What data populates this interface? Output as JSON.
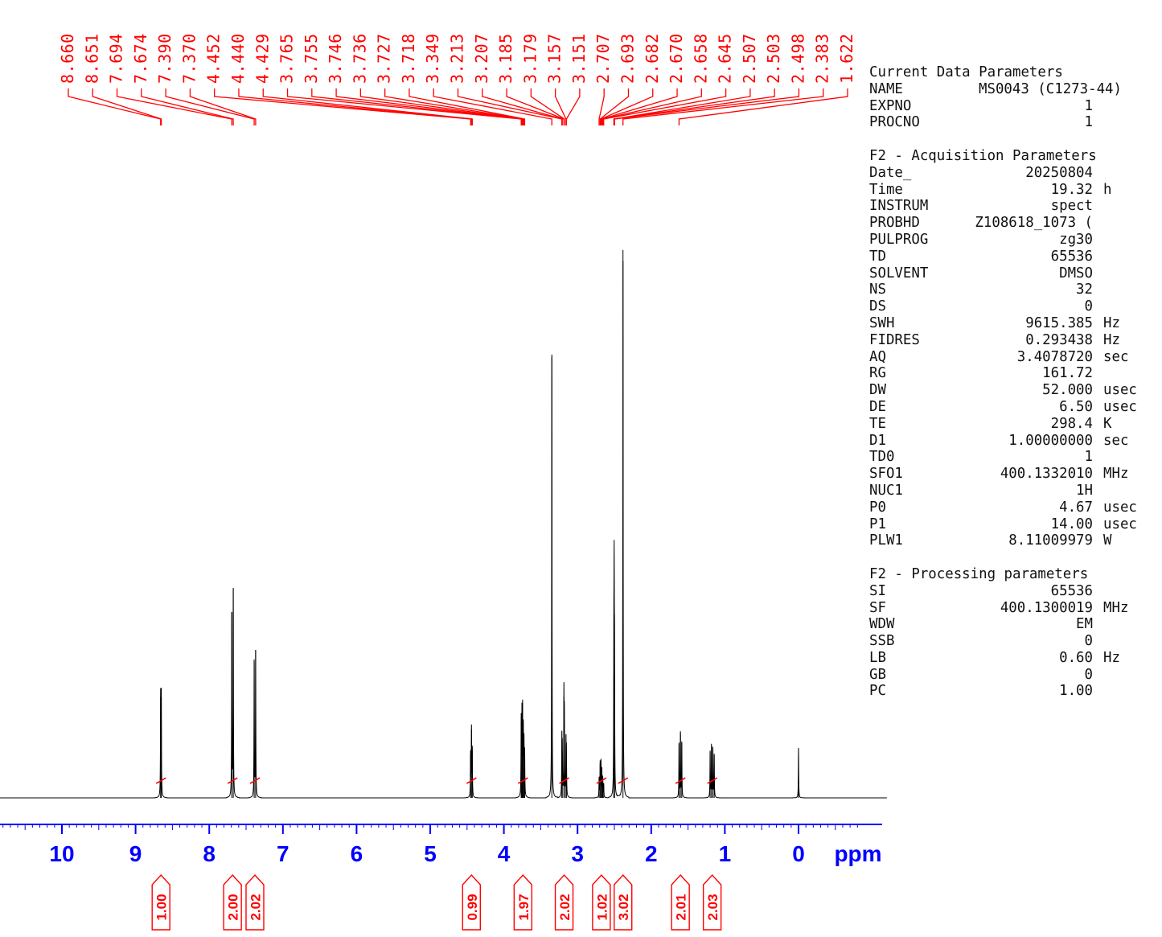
{
  "colors": {
    "spectrum": "#000000",
    "labels": "#ff0000",
    "axis": "#0000ff",
    "integral": "#ff0000"
  },
  "chart_data": {
    "type": "line",
    "description_free": true,
    "x_unit": "ppm",
    "xlim": [
      11.2,
      -0.8
    ],
    "x_reversed": true,
    "x_ticks": [
      "10",
      "9",
      "8",
      "7",
      "6",
      "5",
      "4",
      "3",
      "2",
      "1",
      "0"
    ],
    "x_tick_values": [
      10,
      9,
      8,
      7,
      6,
      5,
      4,
      3,
      2,
      1,
      0
    ],
    "peaks": [
      {
        "ppm": 8.66,
        "height": 0.166
      },
      {
        "ppm": 8.651,
        "height": 0.166
      },
      {
        "ppm": 7.694,
        "height": 0.305
      },
      {
        "ppm": 7.674,
        "height": 0.343
      },
      {
        "ppm": 7.39,
        "height": 0.224
      },
      {
        "ppm": 7.37,
        "height": 0.243
      },
      {
        "ppm": 4.452,
        "height": 0.072
      },
      {
        "ppm": 4.44,
        "height": 0.112
      },
      {
        "ppm": 4.429,
        "height": 0.078
      },
      {
        "ppm": 3.765,
        "height": 0.125
      },
      {
        "ppm": 3.755,
        "height": 0.132
      },
      {
        "ppm": 3.746,
        "height": 0.137
      },
      {
        "ppm": 3.736,
        "height": 0.106
      },
      {
        "ppm": 3.727,
        "height": 0.086
      },
      {
        "ppm": 3.718,
        "height": 0.07
      },
      {
        "ppm": 3.349,
        "height": 0.728
      },
      {
        "ppm": 3.213,
        "height": 0.095
      },
      {
        "ppm": 3.207,
        "height": 0.077
      },
      {
        "ppm": 3.185,
        "height": 0.166
      },
      {
        "ppm": 3.179,
        "height": 0.125
      },
      {
        "ppm": 3.157,
        "height": 0.088
      },
      {
        "ppm": 3.151,
        "height": 0.072
      },
      {
        "ppm": 2.707,
        "height": 0.032
      },
      {
        "ppm": 2.693,
        "height": 0.056
      },
      {
        "ppm": 2.682,
        "height": 0.058
      },
      {
        "ppm": 2.67,
        "height": 0.045
      },
      {
        "ppm": 2.658,
        "height": 0.032
      },
      {
        "ppm": 2.645,
        "height": 0.022
      },
      {
        "ppm": 2.507,
        "height": 0.2
      },
      {
        "ppm": 2.503,
        "height": 0.31
      },
      {
        "ppm": 2.498,
        "height": 0.2
      },
      {
        "ppm": 2.383,
        "height": 0.9
      },
      {
        "ppm": 1.622,
        "height": 0.088
      },
      {
        "ppm": 1.603,
        "height": 0.106
      },
      {
        "ppm": 1.585,
        "height": 0.09
      },
      {
        "ppm": 1.2,
        "height": 0.075
      },
      {
        "ppm": 1.182,
        "height": 0.085
      },
      {
        "ppm": 1.163,
        "height": 0.08
      },
      {
        "ppm": 1.145,
        "height": 0.07
      },
      {
        "ppm": 0.0,
        "height": 0.082
      }
    ],
    "peak_labels": [
      "8.660",
      "8.651",
      "7.694",
      "7.674",
      "7.390",
      "7.370",
      "4.452",
      "4.440",
      "4.429",
      "3.765",
      "3.755",
      "3.746",
      "3.736",
      "3.727",
      "3.718",
      "3.349",
      "3.213",
      "3.207",
      "3.185",
      "3.179",
      "3.157",
      "3.151",
      "2.707",
      "2.693",
      "2.682",
      "2.670",
      "2.658",
      "2.645",
      "2.507",
      "2.503",
      "2.498",
      "2.383",
      "1.622"
    ],
    "integrals": [
      {
        "ppm": 8.655,
        "value": "1.00"
      },
      {
        "ppm": 7.684,
        "value": "2.00"
      },
      {
        "ppm": 7.38,
        "value": "2.02"
      },
      {
        "ppm": 4.44,
        "value": "0.99"
      },
      {
        "ppm": 3.741,
        "value": "1.97"
      },
      {
        "ppm": 3.182,
        "value": "2.02"
      },
      {
        "ppm": 2.676,
        "value": "1.02"
      },
      {
        "ppm": 2.383,
        "value": "3.02"
      },
      {
        "ppm": 1.603,
        "value": "2.01"
      },
      {
        "ppm": 1.172,
        "value": "2.03"
      }
    ]
  },
  "params": [
    {
      "title": "",
      "rows": [
        {
          "key": "Current Data Parameters",
          "value": "",
          "unit": ""
        },
        {
          "key": "NAME",
          "value": "MS0043 (C1273-44)",
          "unit": "",
          "wide": true
        },
        {
          "key": "EXPNO",
          "value": "1",
          "unit": ""
        },
        {
          "key": "PROCNO",
          "value": "1",
          "unit": ""
        }
      ]
    },
    {
      "title": "F2 - Acquisition Parameters",
      "rows": [
        {
          "key": "Date_",
          "value": "20250804",
          "unit": ""
        },
        {
          "key": "Time",
          "value": "19.32",
          "unit": "h"
        },
        {
          "key": "INSTRUM",
          "value": "spect",
          "unit": ""
        },
        {
          "key": "PROBHD",
          "value": "Z108618_1073 (",
          "unit": ""
        },
        {
          "key": "PULPROG",
          "value": "zg30",
          "unit": ""
        },
        {
          "key": "TD",
          "value": "65536",
          "unit": ""
        },
        {
          "key": "SOLVENT",
          "value": "DMSO",
          "unit": ""
        },
        {
          "key": "NS",
          "value": "32",
          "unit": ""
        },
        {
          "key": "DS",
          "value": "0",
          "unit": ""
        },
        {
          "key": "SWH",
          "value": "9615.385",
          "unit": "Hz"
        },
        {
          "key": "FIDRES",
          "value": "0.293438",
          "unit": "Hz"
        },
        {
          "key": "AQ",
          "value": "3.4078720",
          "unit": "sec"
        },
        {
          "key": "RG",
          "value": "161.72",
          "unit": ""
        },
        {
          "key": "DW",
          "value": "52.000",
          "unit": "usec"
        },
        {
          "key": "DE",
          "value": "6.50",
          "unit": "usec"
        },
        {
          "key": "TE",
          "value": "298.4",
          "unit": "K"
        },
        {
          "key": "D1",
          "value": "1.00000000",
          "unit": "sec"
        },
        {
          "key": "TD0",
          "value": "1",
          "unit": ""
        },
        {
          "key": "SFO1",
          "value": "400.1332010",
          "unit": "MHz"
        },
        {
          "key": "NUC1",
          "value": "1H",
          "unit": ""
        },
        {
          "key": "P0",
          "value": "4.67",
          "unit": "usec"
        },
        {
          "key": "P1",
          "value": "14.00",
          "unit": "usec"
        },
        {
          "key": "PLW1",
          "value": "8.11009979",
          "unit": "W"
        }
      ]
    },
    {
      "title": "F2 - Processing parameters",
      "rows": [
        {
          "key": "SI",
          "value": "65536",
          "unit": ""
        },
        {
          "key": "SF",
          "value": "400.1300019",
          "unit": "MHz"
        },
        {
          "key": "WDW",
          "value": "EM",
          "unit": ""
        },
        {
          "key": "SSB",
          "value": "0",
          "unit": ""
        },
        {
          "key": "LB",
          "value": "0.60",
          "unit": "Hz"
        },
        {
          "key": "GB",
          "value": "0",
          "unit": ""
        },
        {
          "key": "PC",
          "value": "1.00",
          "unit": ""
        }
      ]
    }
  ]
}
